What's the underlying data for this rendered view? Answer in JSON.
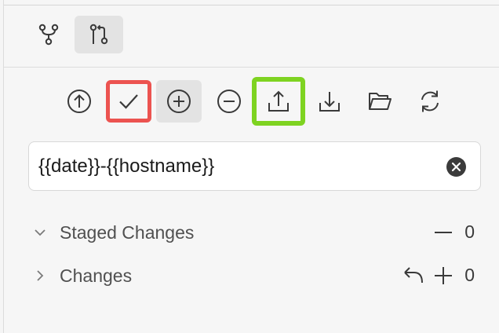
{
  "view_switcher": {
    "items": [
      {
        "icon": "source-control-graph-icon",
        "active": false
      },
      {
        "icon": "pull-request-icon",
        "active": true
      }
    ]
  },
  "toolbar": {
    "buttons": [
      {
        "icon": "arrow-up-circle-icon"
      },
      {
        "icon": "checkmark-icon",
        "highlight": "#ec5350"
      },
      {
        "icon": "plus-circle-icon",
        "hover": true
      },
      {
        "icon": "minus-circle-icon"
      },
      {
        "icon": "upload-icon",
        "highlight": "#7ed321"
      },
      {
        "icon": "download-icon"
      },
      {
        "icon": "folder-open-icon"
      },
      {
        "icon": "refresh-icon"
      }
    ]
  },
  "commit_message": {
    "value": "{{date}}-{{hostname}}"
  },
  "groups": {
    "staged": {
      "label": "Staged Changes",
      "count": "0",
      "expanded": true
    },
    "changes": {
      "label": "Changes",
      "count": "0",
      "expanded": false
    }
  },
  "colors": {
    "red_highlight": "#ec5350",
    "green_highlight": "#7ed321"
  }
}
